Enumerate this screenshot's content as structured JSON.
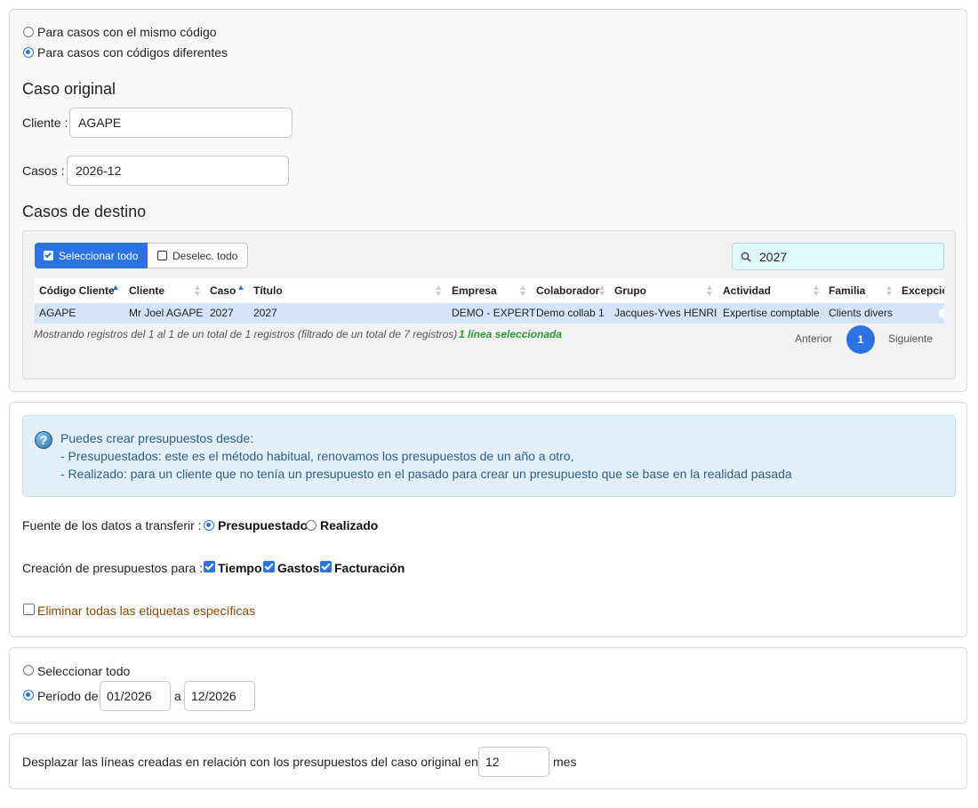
{
  "scope": {
    "option_same": "Para casos con el mismo código",
    "option_diff": "Para casos con códigos diferentes",
    "selected": "diff"
  },
  "original": {
    "heading": "Caso original",
    "client_label": "Cliente :",
    "client_value": "AGAPE",
    "case_label": "Casos :",
    "case_value": "2026-12"
  },
  "destination": {
    "heading": "Casos de destino",
    "select_all_label": "Seleccionar todo",
    "unselect_all_label": "Deselec. todo",
    "search_value": "2027",
    "columns": [
      "Código Cliente",
      "Cliente",
      "Caso",
      "Título",
      "Empresa",
      "Colaborador",
      "Grupo",
      "Actividad",
      "Familia",
      "Excepcio"
    ],
    "rows": [
      [
        "AGAPE",
        "Mr Joel AGAPE",
        "2027",
        "2027",
        "DEMO - EXPERT",
        "Demo collab 1",
        "Jacques-Yves HENRI",
        "Expertise comptable",
        "Clients divers",
        ""
      ]
    ],
    "info": "Mostrando registros del 1 al 1 de un total de 1 registros (filtrado de un total de 7 registros)",
    "selected_info": "1 línea seleccionada",
    "prev_label": "Anterior",
    "current_page": "1",
    "next_label": "Siguiente"
  },
  "help": {
    "line1": "Puedes crear presupuestos desde:",
    "line2": "- Presupuestados: este es el método habitual, renovamos los presupuestos de un año a otro,",
    "line3": "- Realizado: para un cliente que no tenía un presupuesto en el pasado para crear un presupuesto que se base en la realidad pasada"
  },
  "source": {
    "label": "Fuente de los datos a transferir :",
    "opt_budget": "Presupuestado",
    "opt_actual": "Realizado",
    "selected": "budget"
  },
  "creation": {
    "label": "Creación de presupuestos para :",
    "time": "Tiempo",
    "expenses": "Gastos",
    "billing": "Facturación"
  },
  "remove_tags_label": "Eliminar todas las etiquetas específicas",
  "period": {
    "select_all": "Seleccionar todo",
    "period_label": "Período de",
    "from": "01/2026",
    "to_label": "a",
    "to": "12/2026",
    "selected": "period"
  },
  "shift": {
    "label": "Desplazar las líneas creadas en relación con los presupuestos del caso original en",
    "value": "12",
    "unit": "mes"
  },
  "colors": {
    "accent": "#2a73e0",
    "success": "#2e9a2e",
    "warning_text": "#8b4a00",
    "info_bg": "#e2f0fa"
  }
}
